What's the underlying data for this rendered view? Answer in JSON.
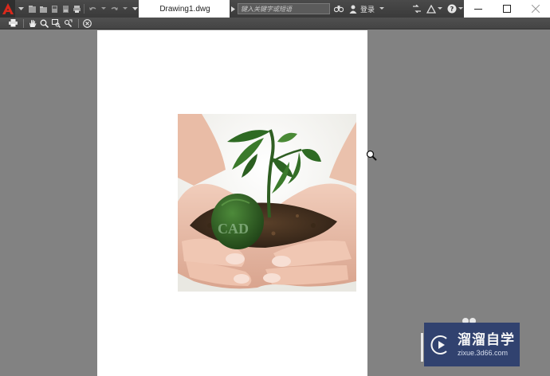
{
  "app": {
    "document_title": "Drawing1.dwg",
    "search_placeholder": "键入关键字或短语",
    "login_label": "登录"
  },
  "watermark": {
    "title": "溜溜自学",
    "url": "zixue.3d66.com"
  },
  "drawing": {
    "photo_caption": "CAD"
  },
  "icons": {
    "app_logo": "autocad-logo-icon",
    "toolbar": [
      "print-icon",
      "pan-hand-icon",
      "zoom-icon",
      "zoom-window-icon",
      "zoom-original-icon",
      "close-preview-icon"
    ]
  },
  "colors": {
    "accent_red": "#d9291c",
    "workspace_gray": "#828282",
    "watermark_blue": "#2b3e6e"
  }
}
